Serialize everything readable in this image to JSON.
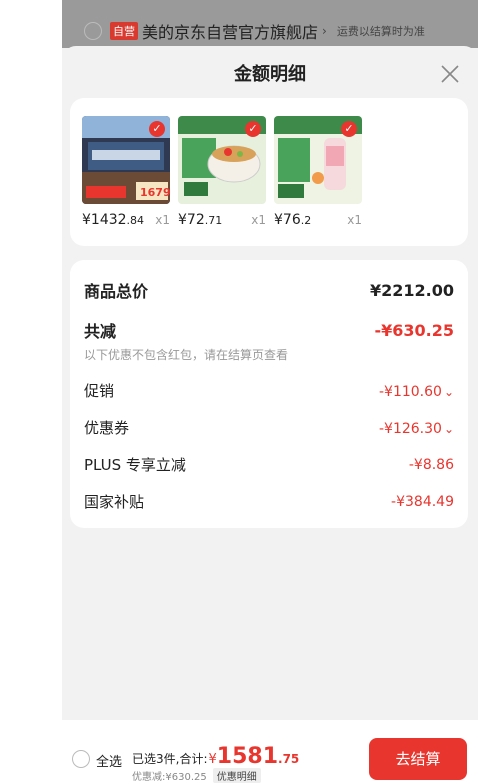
{
  "background_store": {
    "tag": "自营",
    "name": "美的京东自营官方旗舰店",
    "arrow": "›",
    "shipping_note": "运费以结算时为准"
  },
  "sheet": {
    "title": "金额明细",
    "close_icon": "close-icon"
  },
  "products": [
    {
      "price_int": "¥1432",
      "price_dec": ".84",
      "qty": "x1",
      "image": "range-hood-product"
    },
    {
      "price_int": "¥72",
      "price_dec": ".71",
      "qty": "x1",
      "image": "electric-cooker-product"
    },
    {
      "price_int": "¥76",
      "price_dec": ".2",
      "qty": "x1",
      "image": "juicer-cup-product"
    }
  ],
  "detail": {
    "goods_total_label": "商品总价",
    "goods_total_value": "¥2212.00",
    "total_reduction_label": "共减",
    "total_reduction_value": "-¥630.25",
    "note": "以下优惠不包含红包，请在结算页查看",
    "promo_label": "促销",
    "promo_value": "-¥110.60",
    "coupon_label": "优惠券",
    "coupon_value": "-¥126.30",
    "plus_label": "PLUS 专享立减",
    "plus_value": "-¥8.86",
    "subsidy_label": "国家补贴",
    "subsidy_value": "-¥384.49"
  },
  "bottom": {
    "select_all": "全选",
    "selected_text": "已选3件,合计:",
    "currency": "¥",
    "total_int": "1581",
    "total_dec": ".75",
    "discount_text": "优惠减:¥630.25",
    "discount_detail": "优惠明细",
    "checkout": "去结算"
  },
  "colors": {
    "accent": "#e8362e",
    "sheet_bg": "#f2f2f2",
    "card_bg": "#ffffff"
  }
}
